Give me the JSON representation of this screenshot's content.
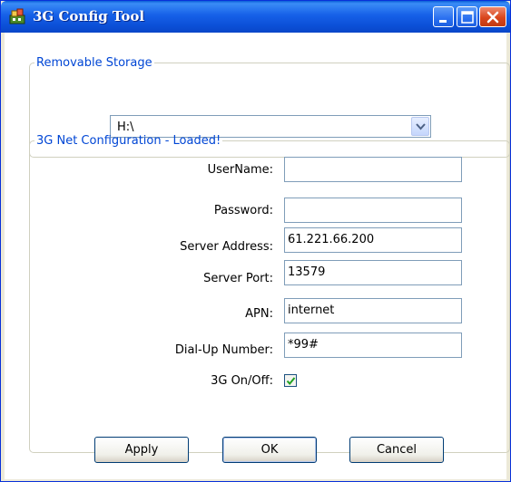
{
  "window": {
    "title": "3G Config Tool"
  },
  "storage_group": {
    "legend": "Removable Storage",
    "selected_drive": "H:\\"
  },
  "net_group": {
    "legend": "3G Net Configuration - Loaded!",
    "fields": [
      {
        "label": "UserName:",
        "value": ""
      },
      {
        "label": "Password:",
        "value": ""
      },
      {
        "label": "Server Address:",
        "value": "61.221.66.200"
      },
      {
        "label": "Server Port:",
        "value": "13579"
      },
      {
        "label": "APN:",
        "value": "internet"
      },
      {
        "label": "Dial-Up Number:",
        "value": "*99#"
      }
    ],
    "toggle": {
      "label": "3G On/Off:",
      "checked": true
    }
  },
  "buttons": {
    "apply": "Apply",
    "ok": "OK",
    "cancel": "Cancel"
  },
  "colors": {
    "accent": "#0046d5",
    "titlebar": "#0b4fd6",
    "close_button": "#d9461c",
    "checkmark": "#21a121"
  },
  "icons": {
    "app": "app-icon",
    "minimize": "minimize-icon",
    "maximize": "maximize-icon",
    "close": "close-icon",
    "dropdown": "chevron-down-icon",
    "check": "checkmark-icon"
  }
}
